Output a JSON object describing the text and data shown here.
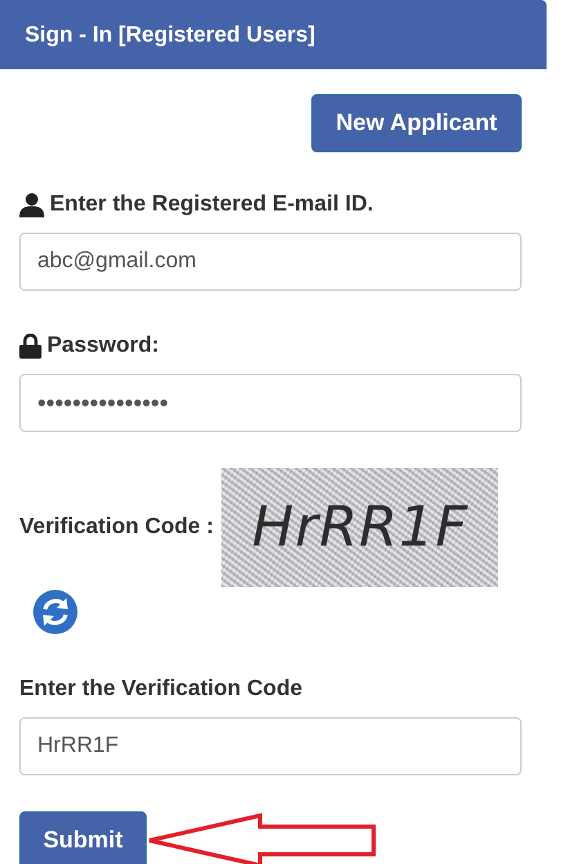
{
  "header": {
    "title": "Sign - In [Registered Users]"
  },
  "new_applicant_button": "New Applicant",
  "fields": [
    {
      "kind": "email",
      "label": "Enter the Registered E-mail ID.",
      "value": "abc@gmail.com"
    },
    {
      "kind": "password",
      "label": "Password:",
      "value": "•••••••••••••••"
    }
  ],
  "captcha": {
    "label": "Verification Code :",
    "code": "HrRR1F"
  },
  "code_field": {
    "label": "Enter the Verification Code",
    "value": "HrRR1F"
  },
  "submit_button": "Submit"
}
